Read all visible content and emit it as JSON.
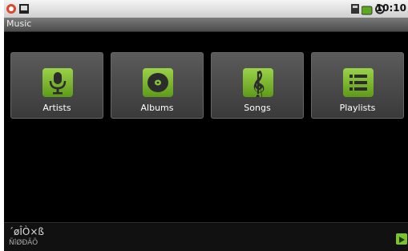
{
  "status_bar": {
    "time": "10:10",
    "icons": [
      "app-icon",
      "notification-icon",
      "sd-card-icon",
      "battery-icon",
      "alarm-icon"
    ]
  },
  "title_bar": {
    "title": "Music"
  },
  "tiles": [
    {
      "label": "Artists",
      "icon": "microphone-icon"
    },
    {
      "label": "Albums",
      "icon": "disc-icon"
    },
    {
      "label": "Songs",
      "icon": "music-note-icon"
    },
    {
      "label": "Playlists",
      "icon": "list-icon"
    }
  ],
  "now_playing": {
    "title": "´øÎÒ×ß",
    "artist": "ÑîØÐÃÕ",
    "play_icon": "play-icon"
  },
  "colors": {
    "accent": "#7bc22e",
    "background": "#000000"
  }
}
